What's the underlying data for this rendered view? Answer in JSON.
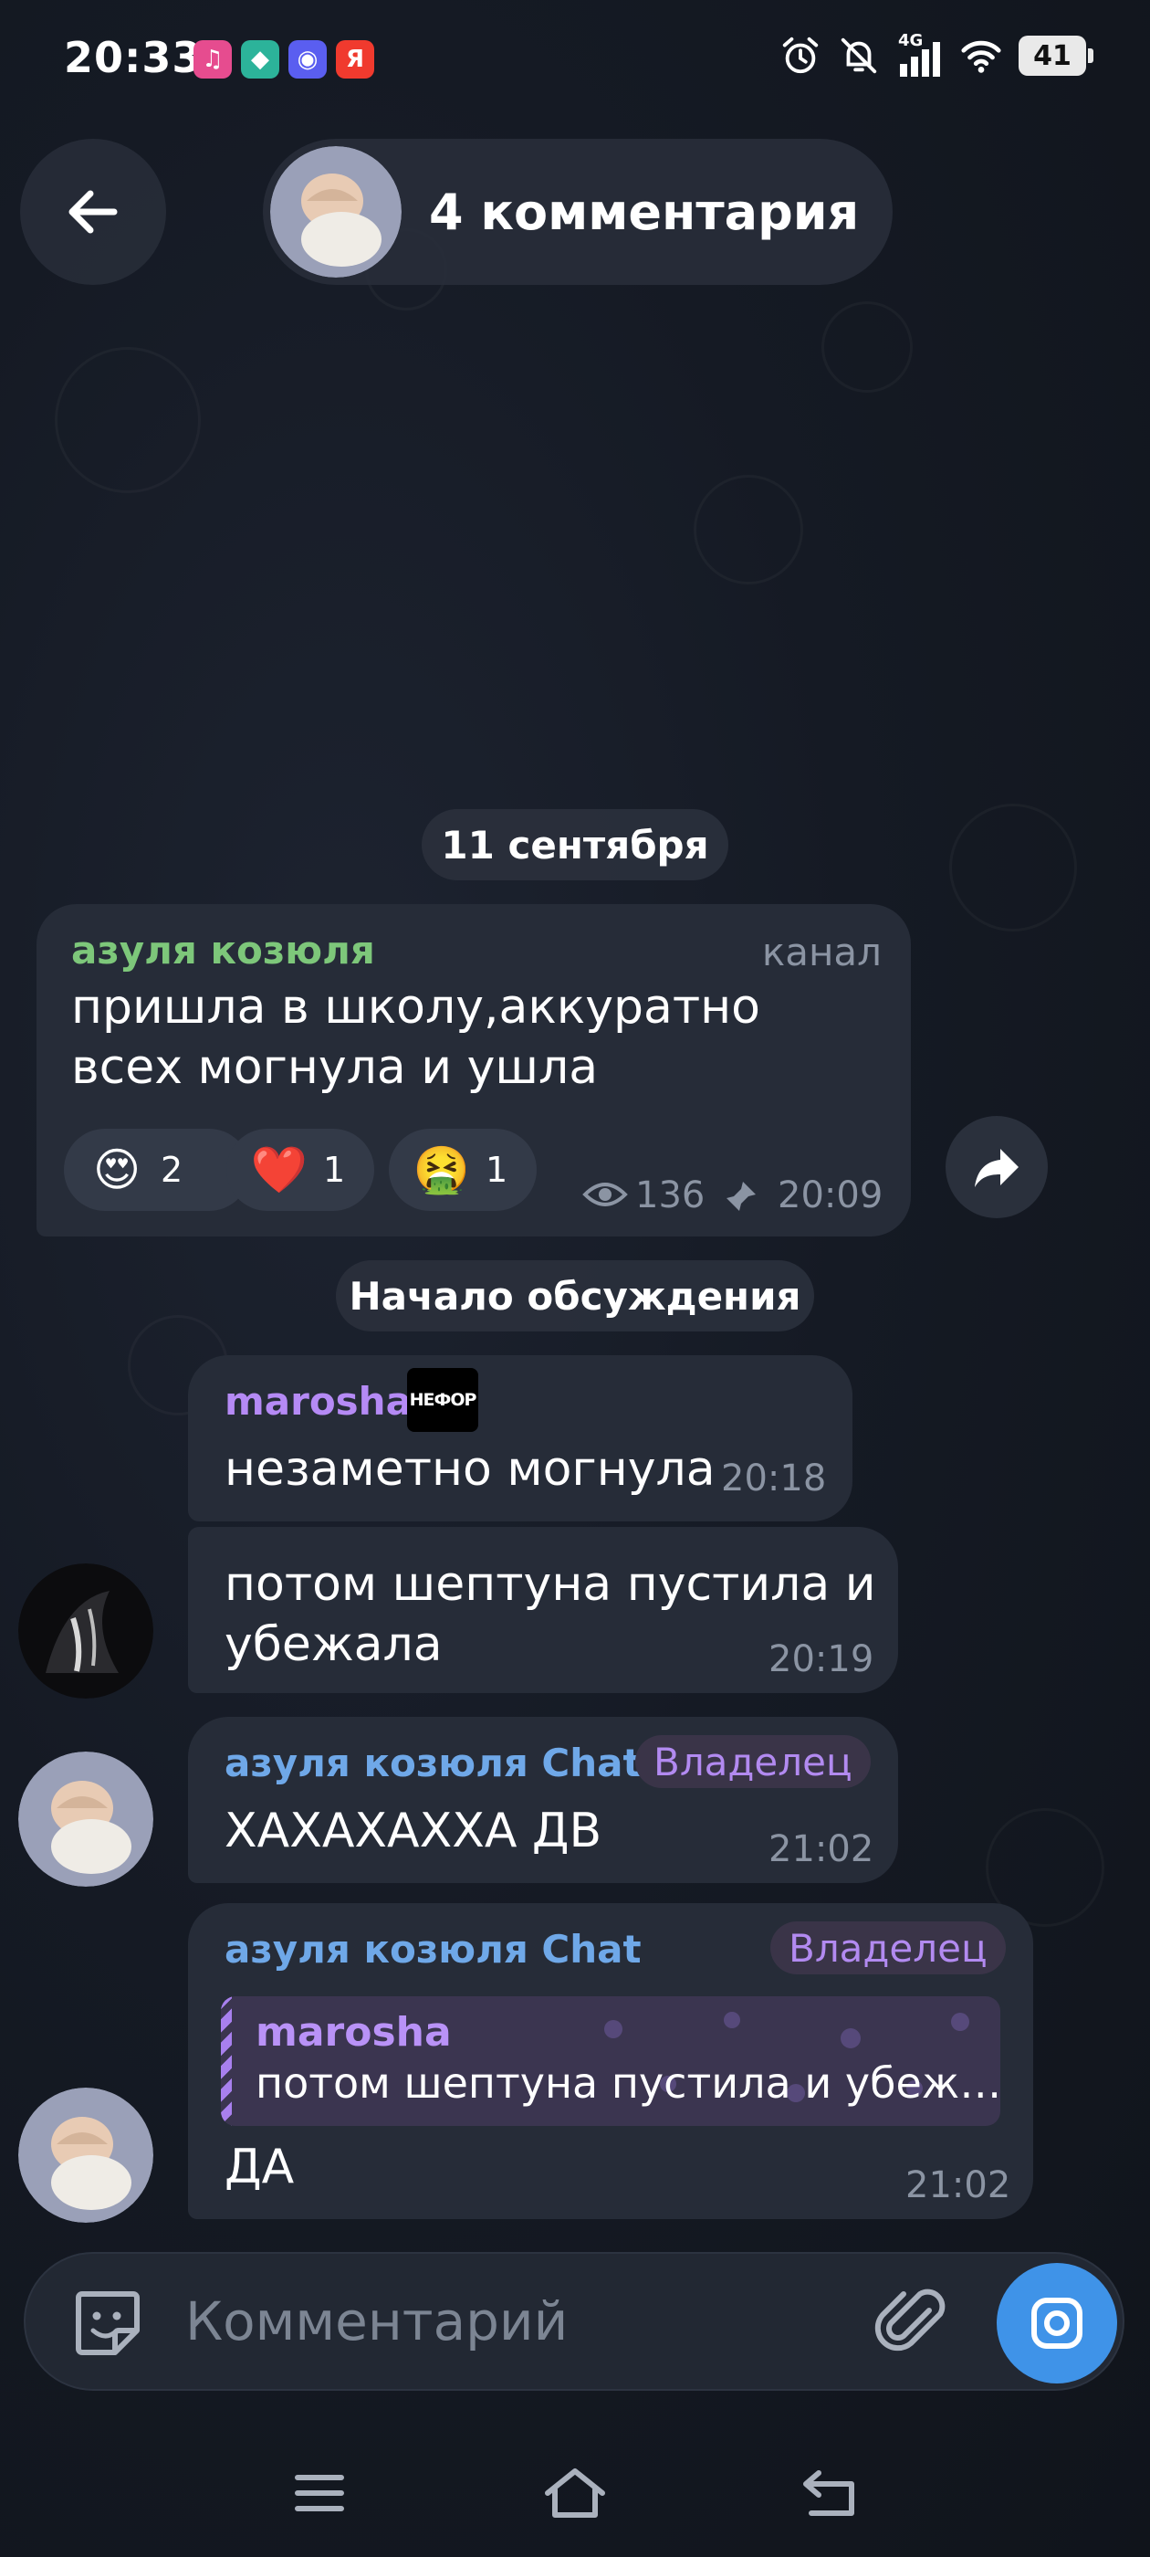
{
  "status_bar": {
    "time": "20:33",
    "apps": [
      {
        "icon": "music-app-icon",
        "glyph": "♫",
        "color": "#e64c8f"
      },
      {
        "icon": "shield-app-icon",
        "glyph": "◆",
        "color": "#2cb39a"
      },
      {
        "icon": "messenger-app-icon",
        "glyph": "◉",
        "color": "#5a5ef0"
      },
      {
        "icon": "yandex-app-icon",
        "glyph": "Я",
        "color": "#f03a2e"
      }
    ],
    "network": "4G",
    "battery": "41"
  },
  "header": {
    "title": "4 комментария"
  },
  "date_chip": "11 сентября",
  "post": {
    "author": "азуля козюля",
    "author_color": "#7dc77a",
    "tag": "канал",
    "text": "пришла в школу,аккуратно всех могнула и ушла",
    "reactions": [
      {
        "emoji": "😍",
        "count": "2"
      },
      {
        "emoji": "❤️",
        "count": "1"
      },
      {
        "emoji": "🤮",
        "count": "1"
      }
    ],
    "views": "136",
    "time": "20:09"
  },
  "discussion_chip": "Начало обсуждения",
  "messages": [
    {
      "author": "marosha",
      "author_color": "#b58af5",
      "badge_emoji": "НЕФОР",
      "text": "незаметно могнула",
      "time": "20:18"
    },
    {
      "text_line1": "потом шептуна пустила и",
      "text_line2": "убежала",
      "time": "20:19"
    },
    {
      "author": "азуля козюля Chat",
      "author_color": "#6fa8e8",
      "role": "Владелец",
      "text": "ХАХАХАХХА ДВ",
      "time": "21:02"
    },
    {
      "author": "азуля козюля Chat",
      "author_color": "#6fa8e8",
      "role": "Владелец",
      "quote_author": "marosha",
      "quote_text": "потом шептуна пустила и убеж…",
      "text": "ДА",
      "time": "21:02"
    }
  ],
  "composer": {
    "placeholder": "Комментарий"
  }
}
